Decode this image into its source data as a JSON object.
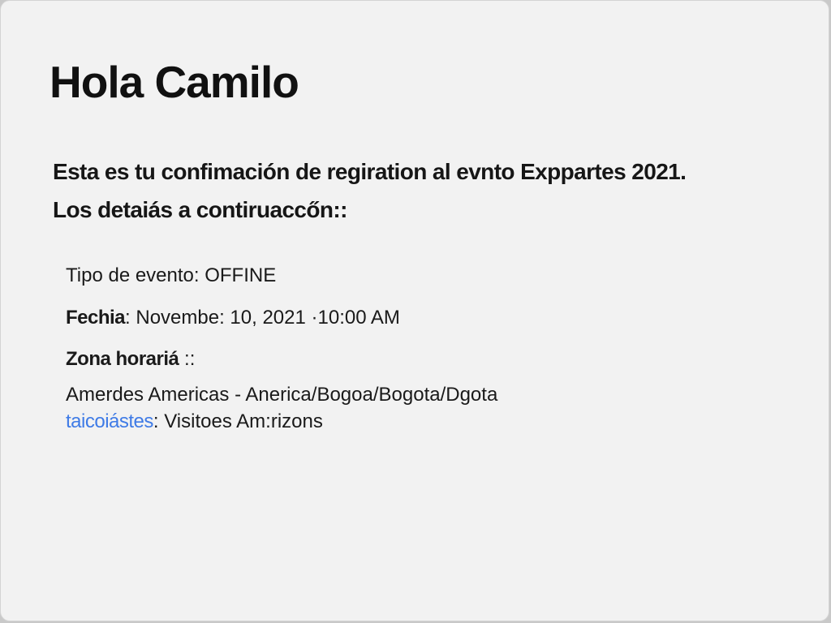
{
  "greeting": "Hola Camilo",
  "intro": {
    "line1": "Esta es tu confimación de regiration al evnto Exppartes 2021.",
    "line2": "Los detaiás a contiruaccőn::"
  },
  "details": {
    "event_type": "Tipo de evento: OFFINE",
    "date_label": "Fechia",
    "date_value": ": Novembe: 10, 2021 ·10:00 AM",
    "timezone_label": "Zona horariá",
    "timezone_suffix": " ::",
    "timezone_value": "Amerdes Americas - Anerica/Bogoa/Bogota/Dgota",
    "guests_link": "taicoiástes",
    "guests_value": ": Visitoes Am:rizons"
  },
  "colors": {
    "background": "#f2f2f2",
    "text": "#111111",
    "link": "#3f7be6"
  }
}
